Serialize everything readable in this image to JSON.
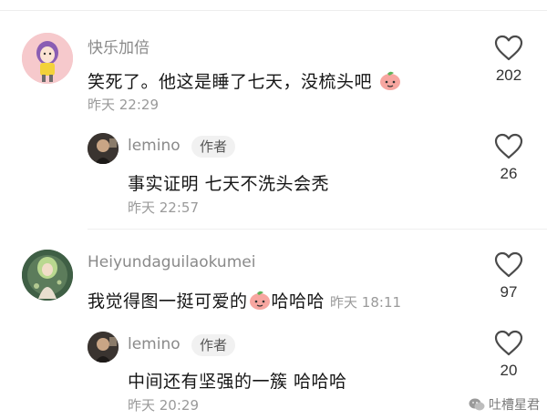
{
  "comments": [
    {
      "author": "快乐加倍",
      "text": "笑死了。他这是睡了七天，没梳头吧",
      "time": "昨天 22:29",
      "likes": "202",
      "replies": [
        {
          "author": "lemino",
          "tag": "作者",
          "text": "事实证明 七天不洗头会秃",
          "time": "昨天 22:57",
          "likes": "26"
        }
      ]
    },
    {
      "author": "Heiyundaguilaokumei",
      "text_before": "我觉得图一挺可爱的",
      "text_after": "哈哈哈",
      "time": "昨天 18:11",
      "likes": "97",
      "replies": [
        {
          "author": "lemino",
          "tag": "作者",
          "text": "中间还有坚强的一簇 哈哈哈",
          "time": "昨天 20:29",
          "likes": "20"
        }
      ]
    }
  ],
  "watermark": "吐槽星君",
  "icons": {
    "like": "heart-outline-icon",
    "emoji": "peach-face-emoji",
    "watermark": "wechat-icon"
  }
}
